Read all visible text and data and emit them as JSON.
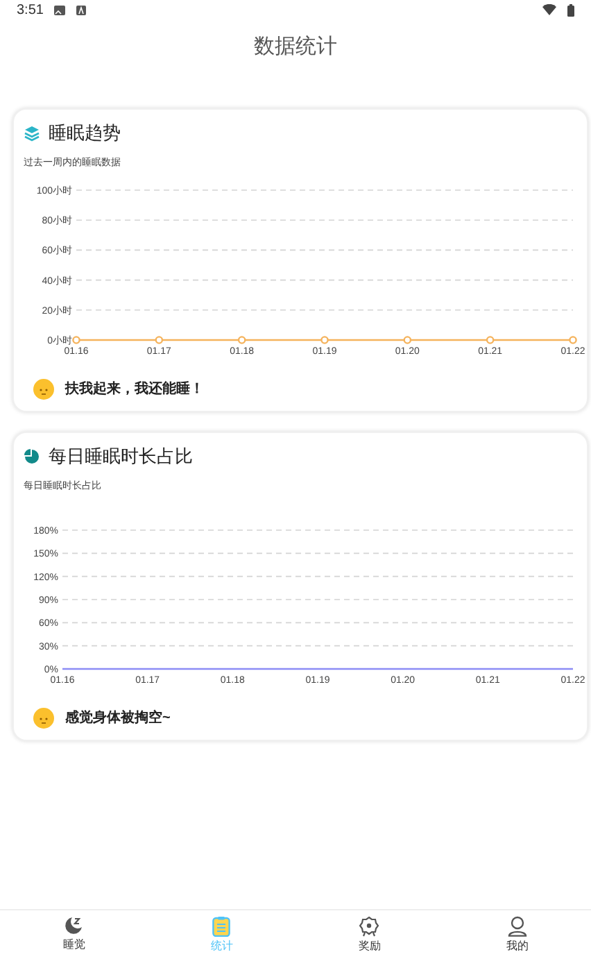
{
  "status_bar": {
    "time": "3:51"
  },
  "title": "数据统计",
  "cards": [
    {
      "title": "睡眠趋势",
      "subtitle": "过去一周内的睡眠数据",
      "message": "扶我起来，我还能睡！",
      "chart_data": {
        "type": "line",
        "grid": true,
        "categories": [
          "01.16",
          "01.17",
          "01.18",
          "01.19",
          "01.20",
          "01.21",
          "01.22"
        ],
        "series": [
          {
            "color": "#f5b35c",
            "marker": true,
            "values": [
              0,
              0,
              0,
              0,
              0,
              0,
              0
            ]
          }
        ],
        "ylim": [
          0,
          100
        ],
        "yticks": [
          {
            "value": 0,
            "label": "0小时"
          },
          {
            "value": 20,
            "label": "20小时"
          },
          {
            "value": 40,
            "label": "40小时"
          },
          {
            "value": 60,
            "label": "60小时"
          },
          {
            "value": 80,
            "label": "80小时"
          },
          {
            "value": 100,
            "label": "100小时"
          }
        ]
      }
    },
    {
      "title": "每日睡眠时长占比",
      "subtitle": "每日睡眠时长占比",
      "message": "感觉身体被掏空~",
      "chart_data": {
        "type": "line",
        "grid": true,
        "categories": [
          "01.16",
          "01.17",
          "01.18",
          "01.19",
          "01.20",
          "01.21",
          "01.22"
        ],
        "series": [
          {
            "color": "#8c8cf5",
            "marker": false,
            "values": [
              0,
              0,
              0,
              0,
              0,
              0,
              0
            ]
          }
        ],
        "ylim": [
          0,
          180
        ],
        "yticks": [
          {
            "value": 0,
            "label": "0%"
          },
          {
            "value": 30,
            "label": "30%"
          },
          {
            "value": 60,
            "label": "60%"
          },
          {
            "value": 90,
            "label": "90%"
          },
          {
            "value": 120,
            "label": "120%"
          },
          {
            "value": 150,
            "label": "150%"
          },
          {
            "value": 180,
            "label": "180%"
          }
        ]
      }
    }
  ],
  "tabs": [
    {
      "label": "睡觉",
      "selected": false
    },
    {
      "label": "统计",
      "selected": true
    },
    {
      "label": "奖励",
      "selected": false
    },
    {
      "label": "我的",
      "selected": false
    }
  ]
}
